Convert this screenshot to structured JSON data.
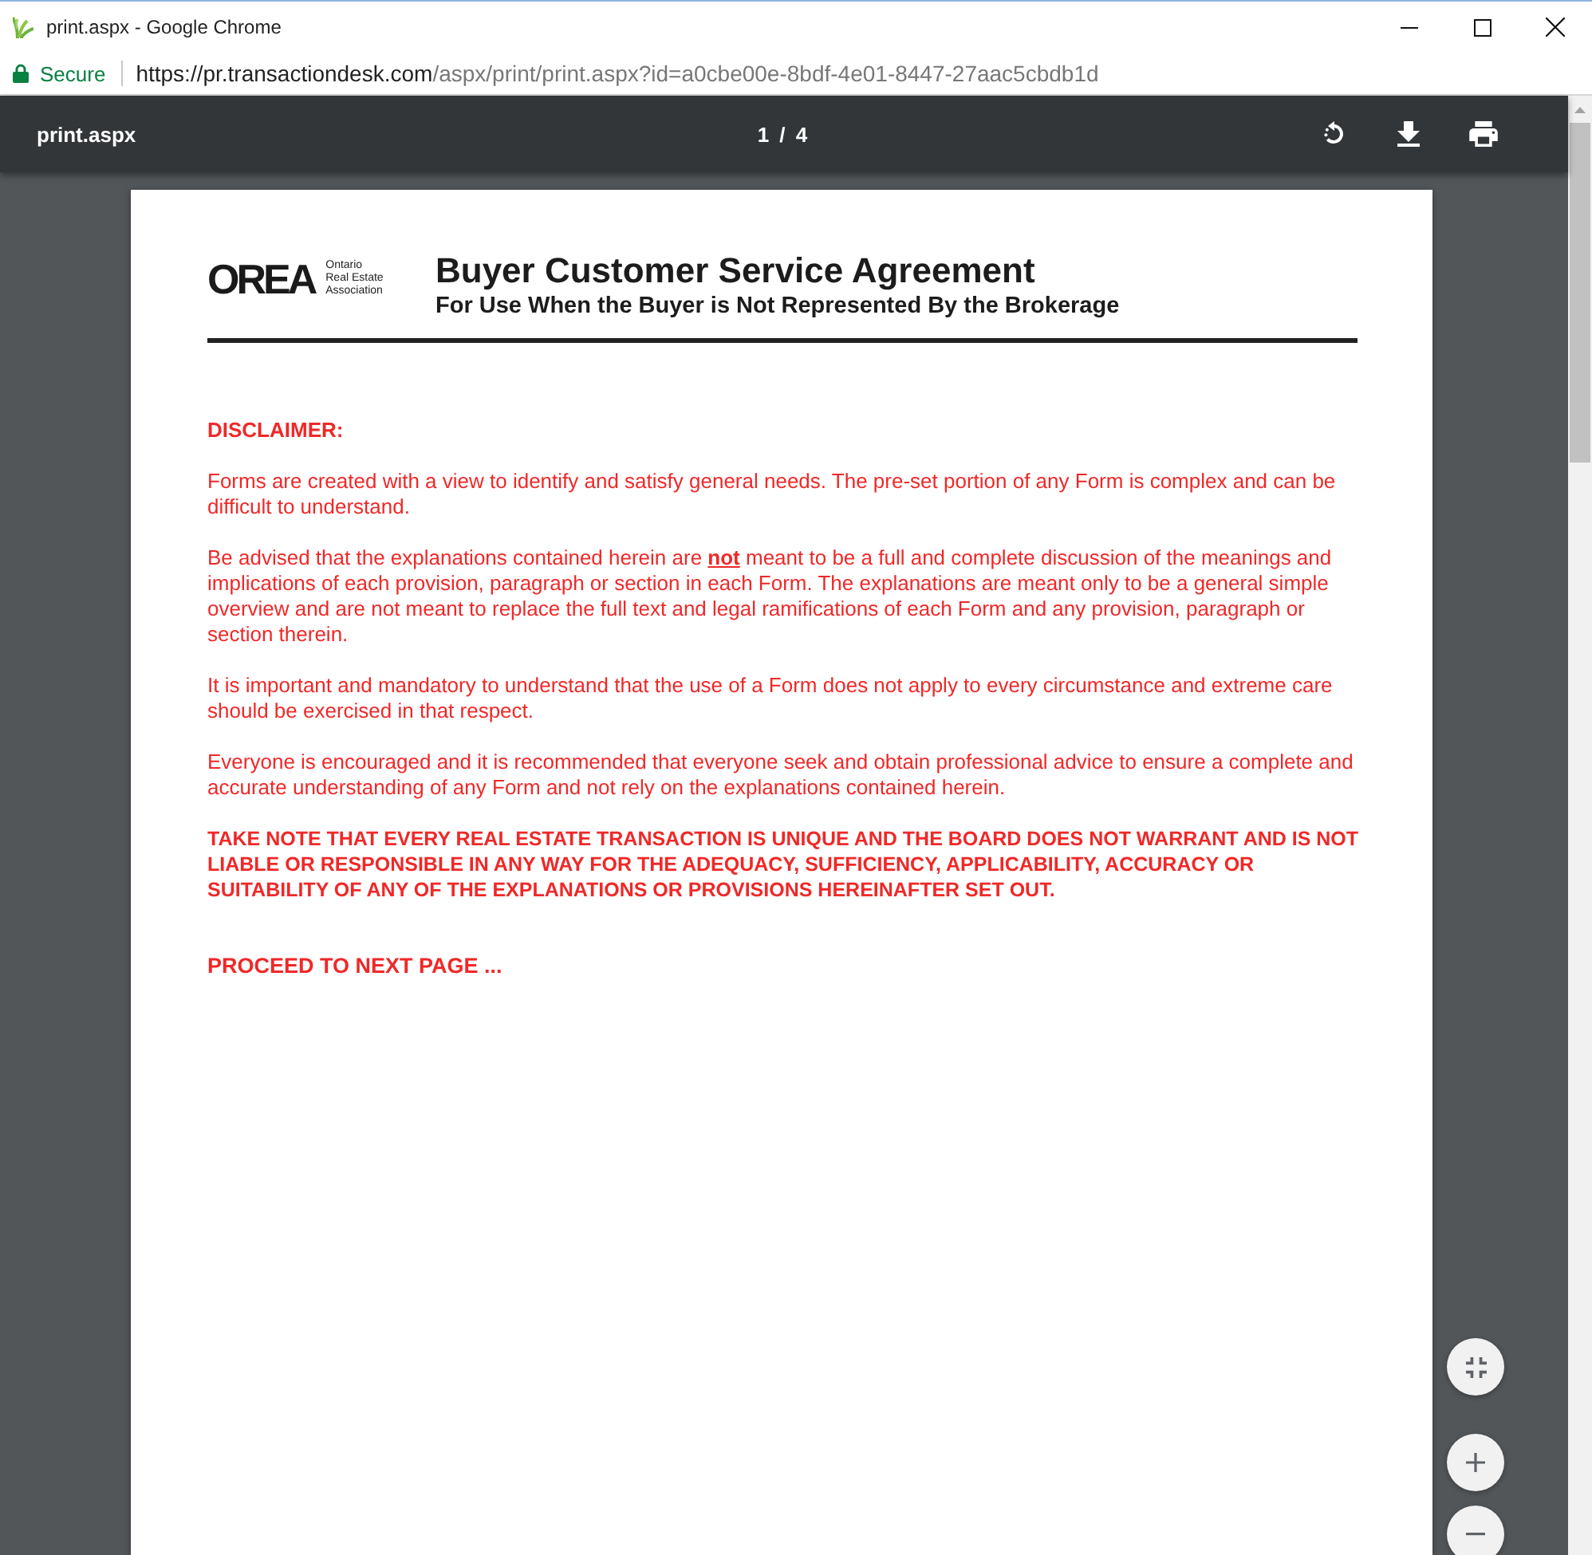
{
  "window": {
    "title": "print.aspx - Google Chrome"
  },
  "address_bar": {
    "security_label": "Secure",
    "url": {
      "host": "https://pr.transactiondesk.com",
      "path": "/aspx/print/print.aspx?id=a0cbe00e-8bdf-4e01-8447-27aac5cbdb1d"
    }
  },
  "pdf_toolbar": {
    "file_name": "print.aspx",
    "page_indicator": "1 / 4"
  },
  "document": {
    "logo": {
      "wordmark": "OREA",
      "org_name_lines": [
        "Ontario",
        "Real Estate",
        "Association"
      ]
    },
    "title": "Buyer Customer Service Agreement",
    "subtitle": "For Use When the Buyer is Not Represented By the Brokerage",
    "heading": "DISCLAIMER:",
    "paragraphs": [
      "Forms are created with a view to identify and satisfy general needs. The pre-set portion of any Form is complex and can be difficult to understand.",
      "Be advised that the explanations contained herein are **not** meant to be a full and complete discussion of the meanings and implications of each provision, paragraph or section in each Form. The explanations are meant only to be a general simple overview and are not meant to replace the full text and legal ramifications of each Form and any provision, paragraph or section therein.",
      "It is important and mandatory to understand that the use of a Form does not apply to every circumstance and extreme care should be exercised in that respect.",
      "Everyone is encouraged and it is recommended that everyone seek and obtain professional advice to ensure a complete and accurate understanding of any Form and not rely on the explanations contained herein."
    ],
    "notice": "TAKE NOTE THAT EVERY REAL ESTATE TRANSACTION IS UNIQUE AND THE BOARD DOES NOT WARRANT AND IS NOT LIABLE OR RESPONSIBLE IN ANY WAY FOR THE ADEQUACY, SUFFICIENCY, APPLICABILITY, ACCURACY OR SUITABILITY OF ANY OF THE EXPLANATIONS OR PROVISIONS HEREINAFTER SET OUT.",
    "next_page_note": "PROCEED TO NEXT PAGE ..."
  }
}
